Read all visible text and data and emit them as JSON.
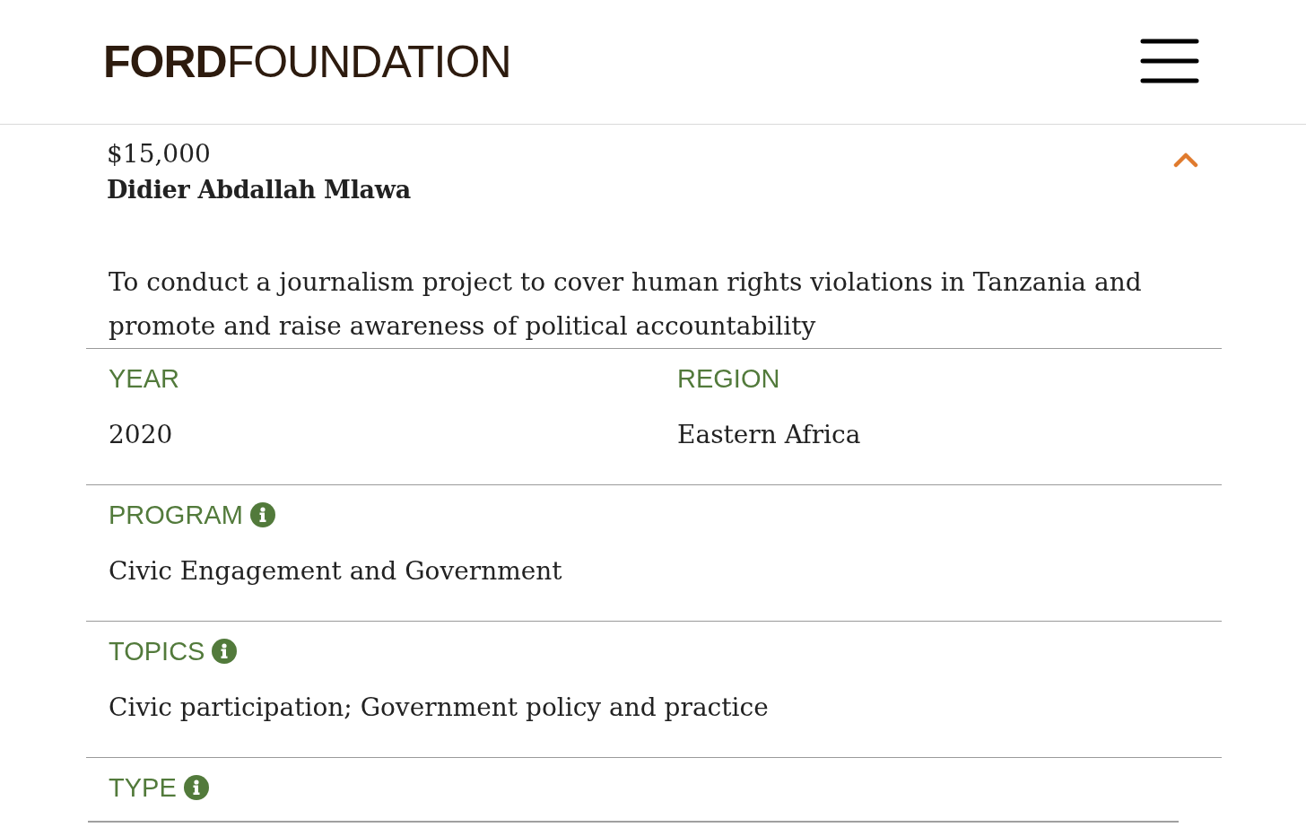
{
  "header": {
    "logo": "**FORD**FOUNDATION"
  },
  "grant": {
    "amount": "$15,000",
    "grantee": "Didier Abdallah Mlawa",
    "expanded": true,
    "description": "To conduct a journalism project to cover human rights violations in Tanzania and promote and raise awareness of political accountability"
  },
  "details": [
    {
      "cells": [
        {
          "label": "YEAR",
          "info": false,
          "value": "2020"
        },
        {
          "label": "REGION",
          "info": false,
          "value": "Eastern Africa"
        }
      ]
    },
    {
      "cells": [
        {
          "label": "PROGRAM",
          "info": true,
          "value": "Civic Engagement and Government"
        }
      ]
    },
    {
      "cells": [
        {
          "label": "TOPICS",
          "info": true,
          "value": "Civic participation; Government policy and practice"
        }
      ]
    },
    {
      "cells": [
        {
          "label": "TYPE",
          "info": true
        }
      ]
    }
  ]
}
